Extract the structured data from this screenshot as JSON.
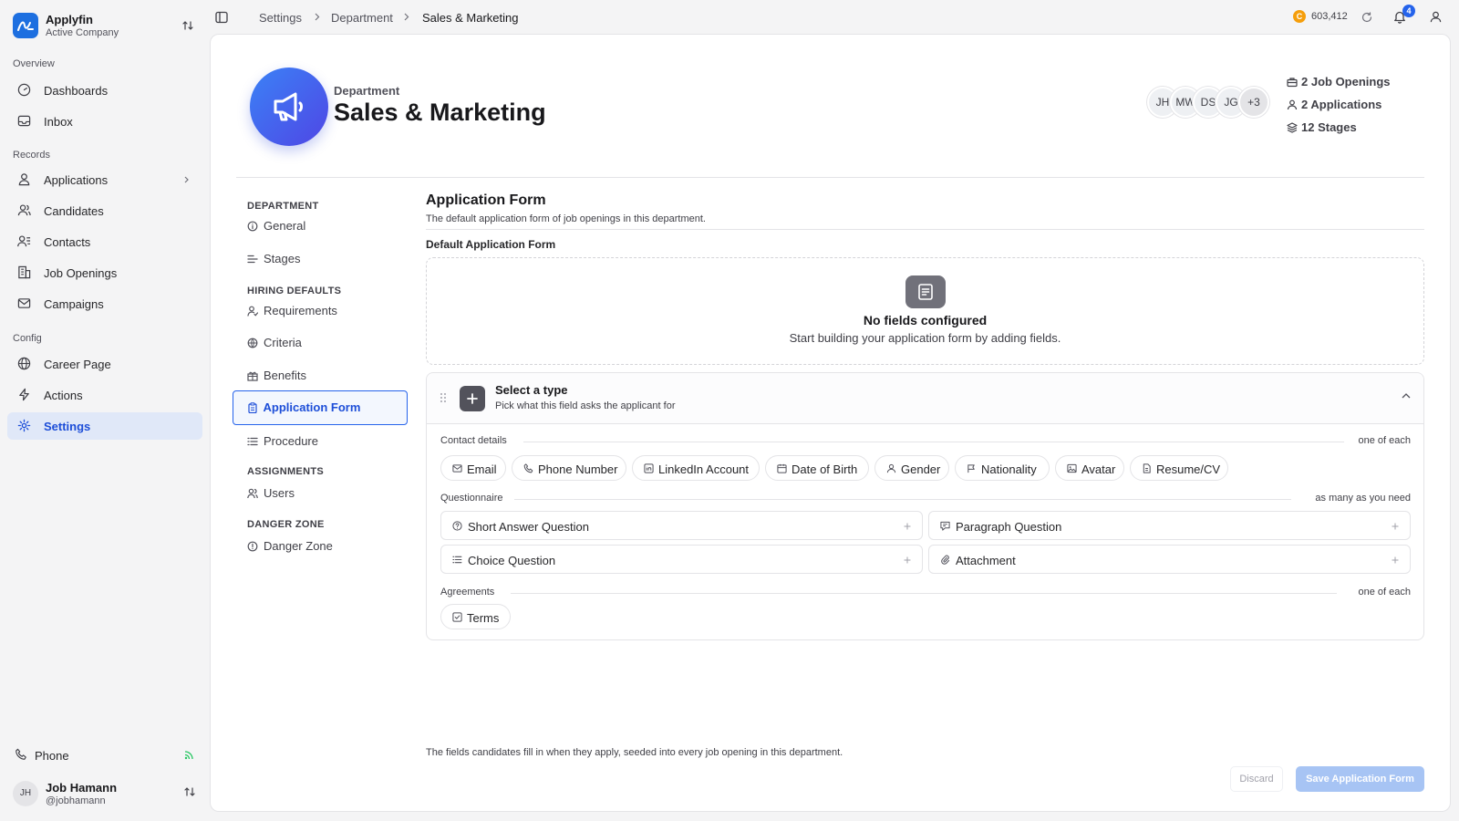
{
  "brand": {
    "name": "Applyfin",
    "company": "Active Company"
  },
  "sidebar": {
    "sections": [
      "Overview",
      "Records",
      "Config"
    ],
    "overview": [
      {
        "label": "Dashboards",
        "icon": "gauge-icon"
      },
      {
        "label": "Inbox",
        "icon": "inbox-icon"
      }
    ],
    "records": [
      {
        "label": "Applications",
        "icon": "user-icon"
      },
      {
        "label": "Candidates",
        "icon": "users-icon"
      },
      {
        "label": "Contacts",
        "icon": "contacts-icon"
      },
      {
        "label": "Job Openings",
        "icon": "building-icon"
      },
      {
        "label": "Campaigns",
        "icon": "mail-icon"
      }
    ],
    "config": [
      {
        "label": "Career Page",
        "icon": "globe-icon"
      },
      {
        "label": "Actions",
        "icon": "bolt-icon"
      },
      {
        "label": "Settings",
        "icon": "gear-icon",
        "active": true
      }
    ],
    "phone_label": "Phone",
    "user": {
      "initials": "JH",
      "name": "Job Hamann",
      "handle": "@jobhamann"
    }
  },
  "topbar": {
    "breadcrumb": [
      "Settings",
      "Department",
      "Sales & Marketing"
    ],
    "credits": "603,412",
    "coin_glyph": "C",
    "notifications": "4"
  },
  "department": {
    "kicker": "Department",
    "title": "Sales & Marketing",
    "members": [
      "JH",
      "MW",
      "DS",
      "JG",
      "+3"
    ],
    "stats": [
      "2 Job Openings",
      "2 Applications",
      "12 Stages"
    ]
  },
  "subnav": {
    "groups": [
      "DEPARTMENT",
      "HIRING DEFAULTS",
      "ASSIGNMENTS",
      "DANGER ZONE"
    ],
    "department": [
      "General",
      "Stages"
    ],
    "hiring": [
      "Requirements",
      "Criteria",
      "Benefits",
      "Application Form",
      "Procedure"
    ],
    "assignments": [
      "Users"
    ],
    "danger": [
      "Danger Zone"
    ]
  },
  "content": {
    "title": "Application Form",
    "subtitle": "The default application form of job openings in this department.",
    "form_label": "Default Application Form",
    "empty_title": "No fields configured",
    "empty_sub": "Start building your application form by adding fields.",
    "select_title": "Select a type",
    "select_sub": "Pick what this field asks the applicant for",
    "contact_label": "Contact details",
    "contact_note": "one of each",
    "contact_fields": [
      "Email",
      "Phone Number",
      "LinkedIn Account",
      "Date of Birth",
      "Gender",
      "Nationality",
      "Avatar",
      "Resume/CV"
    ],
    "questionnaire_label": "Questionnaire",
    "questionnaire_note": "as many as you need",
    "questions": [
      "Short Answer Question",
      "Paragraph Question",
      "Choice Question",
      "Attachment"
    ],
    "agreements_label": "Agreements",
    "agreements_note": "one of each",
    "agreements": [
      "Terms"
    ],
    "footer_note": "The fields candidates fill in when they apply, seeded into every job opening in this department.",
    "discard_label": "Discard",
    "save_label": "Save Application Form"
  },
  "colors": {
    "accent": "#2563eb",
    "active_bg": "#e0e8f8",
    "save_disabled": "#a7c4f4",
    "coin": "#f59e0b",
    "phone_rss": "#22c55e"
  }
}
